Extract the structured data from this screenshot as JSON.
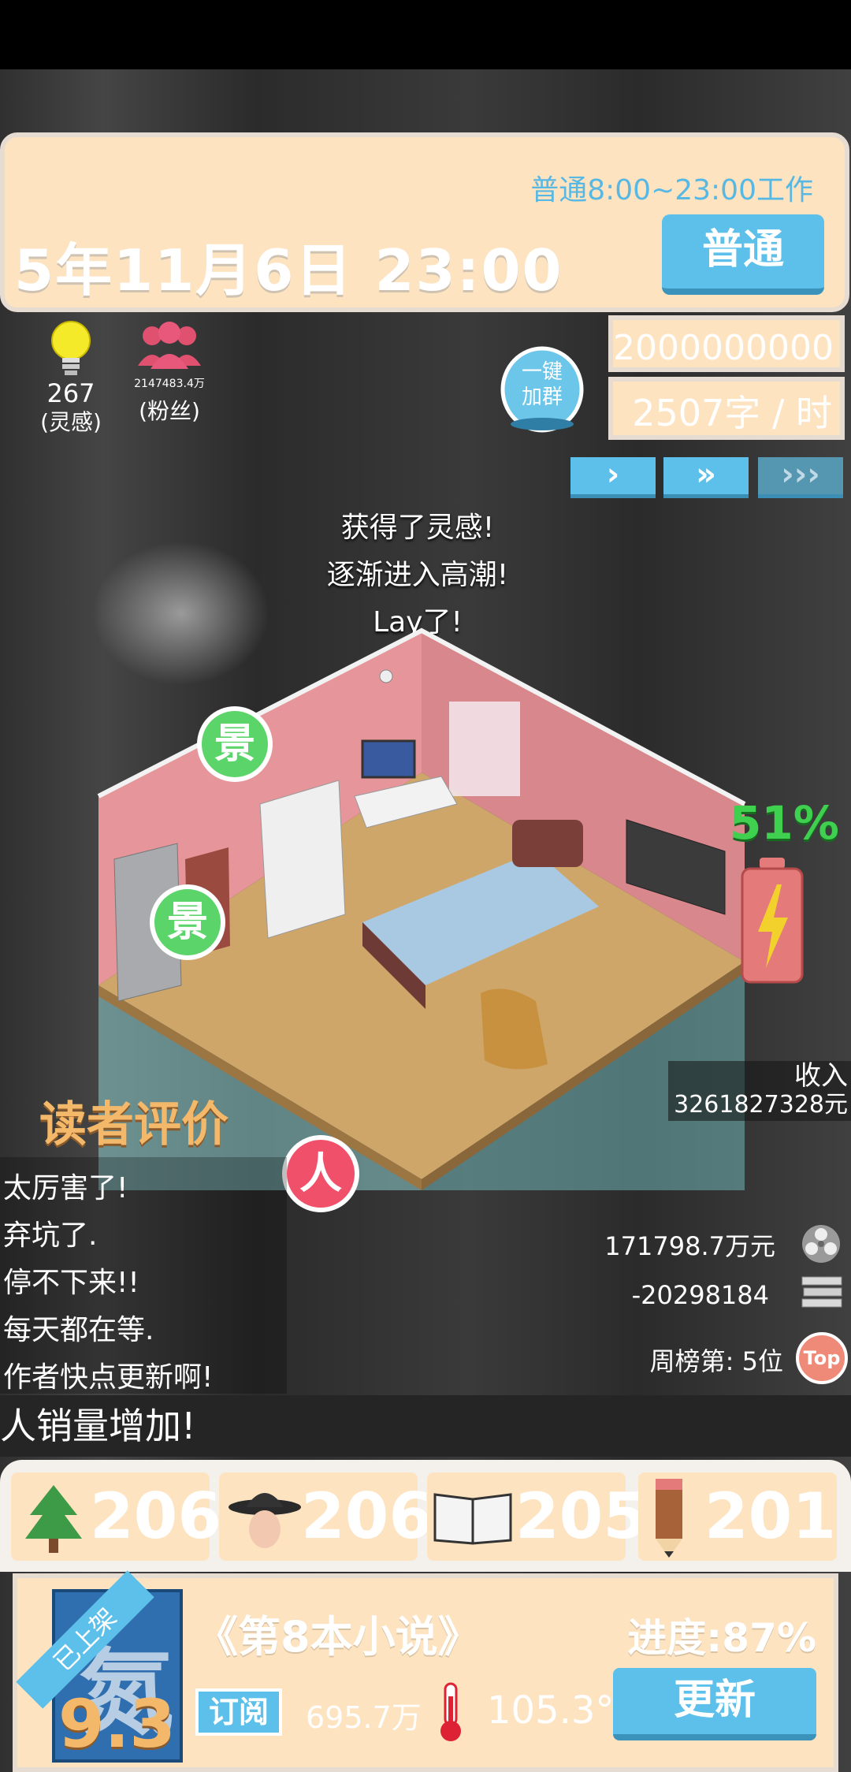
{
  "header": {
    "work_hours": "普通8:00~23:00工作",
    "datetime": "5年11月6日  23:00",
    "mode_button": "普通"
  },
  "stats": {
    "inspiration_value": "267",
    "inspiration_label": "(灵感)",
    "fans_value": "2147483.4万",
    "fans_label": "(粉丝)",
    "group_button": "一键加群",
    "money": "2000000000元",
    "speed": "2507字 / 时"
  },
  "speed_controls": {
    "speed1": "›",
    "speed2": "»",
    "speed3": "›››"
  },
  "messages": [
    "获得了灵感!",
    "逐渐进入高潮!",
    "Lay了!"
  ],
  "badges": {
    "scene1": "景",
    "scene2": "景",
    "person": "人"
  },
  "battery": {
    "percent_label": "51%",
    "level": 0.51
  },
  "income": {
    "label": "收入",
    "value": "3261827328元"
  },
  "reviews": {
    "title": "读者评价",
    "items": [
      "太厉害了!",
      "弃坑了.",
      "停不下来!!",
      "每天都在等.",
      "作者快点更新啊!"
    ]
  },
  "right_stats": {
    "value1": "171798.7万元",
    "value2": "-20298184",
    "rank": "周榜第: 5位",
    "top_badge": "Top"
  },
  "ticker": "人销量增加!",
  "attributes": [
    {
      "icon": "tree-icon",
      "value": "206"
    },
    {
      "icon": "detective-icon",
      "value": "206"
    },
    {
      "icon": "book-icon",
      "value": "205"
    },
    {
      "icon": "pencil-icon",
      "value": "201"
    }
  ],
  "book": {
    "status_ribbon": "已上架",
    "cover_char": "氮",
    "score": "9.3",
    "title": "《第8本小说》",
    "progress": "进度:87%",
    "subscribe_label": "订阅",
    "subscribers": "695.7万",
    "heat": "105.3°",
    "update_button": "更新"
  },
  "colors": {
    "accent_blue": "#5cc0ea",
    "panel_cream": "#fde3c0",
    "green_badge": "#5bd46a",
    "red_badge": "#f0506a",
    "battery_green": "#3fd04f"
  }
}
